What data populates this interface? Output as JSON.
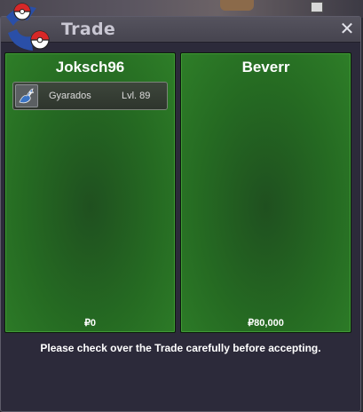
{
  "window": {
    "title": "Trade",
    "close_glyph": "✕"
  },
  "trade": {
    "left": {
      "player": "Joksch96",
      "items": [
        {
          "icon": "gyarados-icon",
          "name": "Gyarados",
          "level": "Lvl. 89"
        }
      ],
      "money": "₽0"
    },
    "right": {
      "player": "Beverr",
      "items": [],
      "money": "₽80,000"
    }
  },
  "notice": "Please check over the Trade carefully before accepting."
}
